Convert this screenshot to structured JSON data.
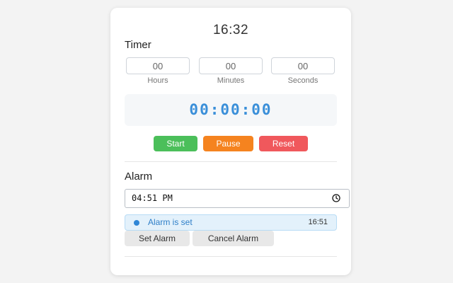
{
  "clock": {
    "time": "16:32"
  },
  "timer": {
    "title": "Timer",
    "hours": {
      "value": "00",
      "label": "Hours"
    },
    "minutes": {
      "value": "00",
      "label": "Minutes"
    },
    "seconds": {
      "value": "00",
      "label": "Seconds"
    },
    "display": "00:00:00",
    "buttons": {
      "start": "Start",
      "pause": "Pause",
      "reset": "Reset"
    }
  },
  "alarm": {
    "title": "Alarm",
    "input_value": "04:51 PM",
    "status_text": "Alarm is set",
    "status_time": "16:51",
    "buttons": {
      "set": "Set Alarm",
      "cancel": "Cancel Alarm"
    }
  },
  "colors": {
    "start": "#4bbf5a",
    "pause": "#f5831f",
    "reset": "#f0585c",
    "display_text": "#3a8fd9",
    "status_bg": "#e3f1fb"
  },
  "icons": {
    "time_picker": "clock-icon",
    "status": "dot-icon"
  }
}
